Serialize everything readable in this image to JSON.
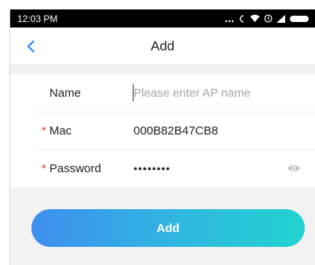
{
  "status_bar": {
    "time": "12:03 PM",
    "icons": [
      "more-dots-icon",
      "call-icon",
      "wifi-icon",
      "alarm-icon",
      "signal-icon",
      "battery-icon"
    ]
  },
  "header": {
    "title": "Add",
    "back_icon": "chevron-left-icon"
  },
  "form": {
    "name": {
      "label": "Name",
      "value": "",
      "placeholder": "Please enter AP name",
      "required": false
    },
    "mac": {
      "label": "Mac",
      "value": "000B82B47CB8",
      "required": true
    },
    "password": {
      "label": "Password",
      "value": "Password",
      "required": true,
      "masked": true,
      "toggle_icon": "eye-icon"
    },
    "required_mark": "*"
  },
  "actions": {
    "add_label": "Add"
  },
  "colors": {
    "accent": "#2f86f6",
    "required": "#e83a3a",
    "button_gradient_start": "#3f8ef0",
    "button_gradient_end": "#22d3cf",
    "page_background": "#f2f2f2"
  }
}
